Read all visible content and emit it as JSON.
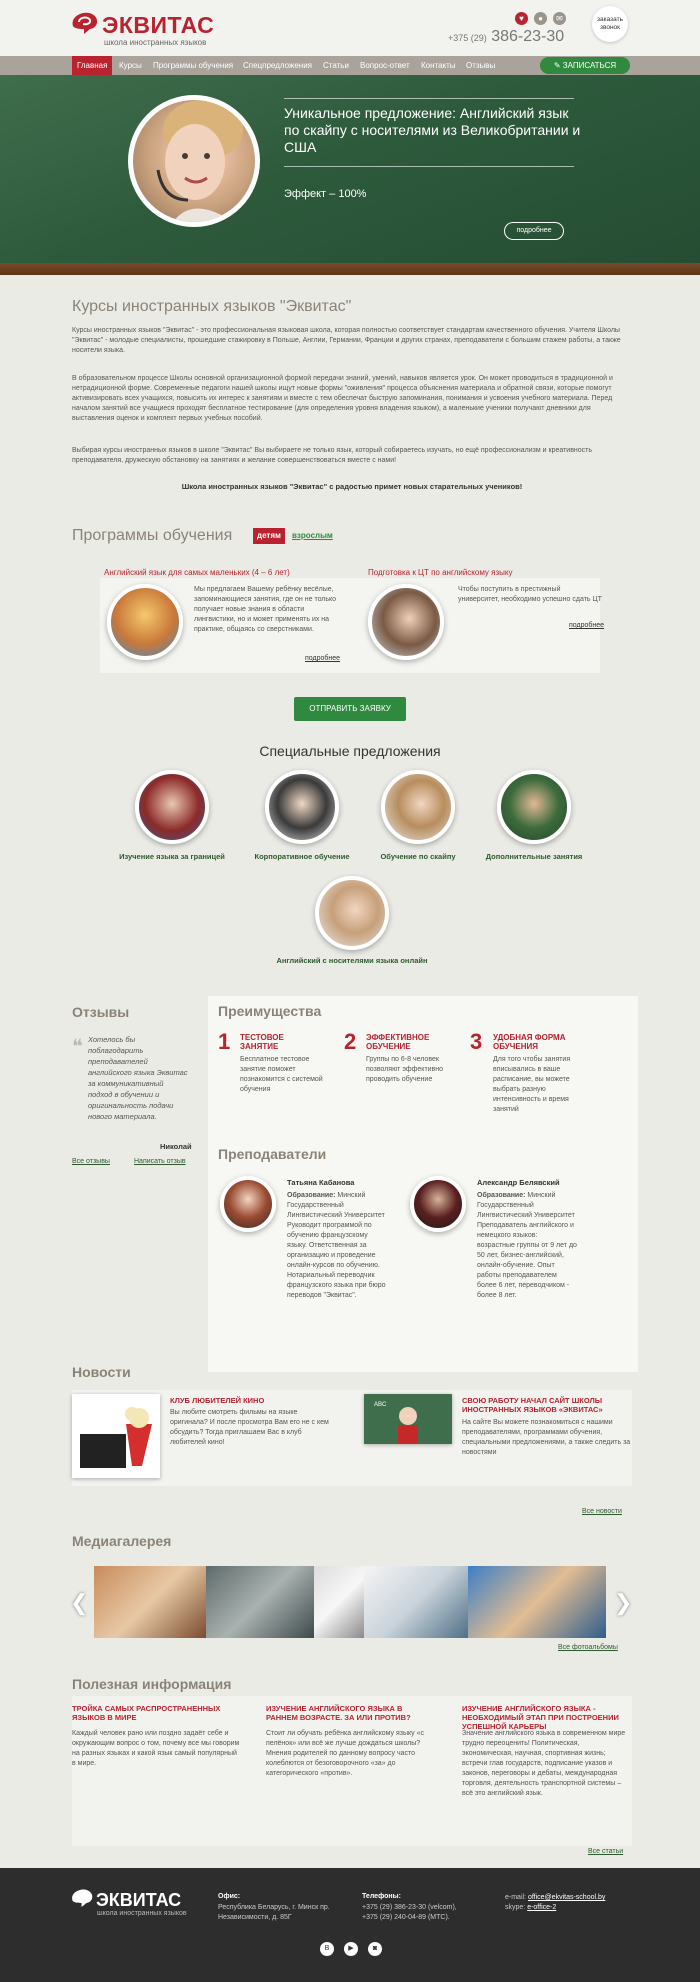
{
  "header": {
    "logo_text": "ЭКВИТАС",
    "logo_sub": "школа иностранных языков",
    "phone_code": "+375 (29)",
    "phone_number": "386-23-30",
    "callback": "заказать звонок",
    "icons": [
      "heart-icon",
      "person-icon",
      "mail-icon"
    ]
  },
  "nav": {
    "items": [
      "Главная",
      "Курсы",
      "Программы обучения",
      "Спецпредложения",
      "Статьи",
      "Вопрос-ответ",
      "Контакты",
      "Отзывы"
    ],
    "signup": "ЗАПИСАТЬСЯ"
  },
  "hero": {
    "title": "Уникальное предложение: Английский язык по скайпу с носителями из Великобритании и США",
    "effect": "Эффект – 100%",
    "more": "подробнее"
  },
  "about": {
    "title": "Курсы иностранных языков \"Эквитас\"",
    "p1": "Курсы иностранных языков \"Эквитас\" - это профессиональная языковая школа, которая полностью соответствует стандартам качественного обучения. Учителя Школы \"Эквитас\" - молодые специалисты, прошедшие стажировку в Польше, Англии, Германии, Франции и других странах, преподаватели с большим стажем работы, а также носители языка.",
    "p2": "В образовательном процессе Школы основной организационной формой передачи знаний, умений, навыков является урок. Он может проводиться в традиционной и нетрадиционной форме. Современные педагоги нашей школы ищут новые формы \"оживления\" процесса объяснения материала и обратной связи, которые помогут активизировать всех учащихся, повысить их интерес к занятиям и вместе с тем обеспечат быструю запоминания, понимания и усвоения учебного материала. Перед началом занятий все учащиеся проходят бесплатное тестирование (для определения уровня владения языком), а маленькие ученики получают дневники для выставления оценок и комплект первых учебных пособий.",
    "p3": "Выбирая курсы иностранных языков в школе \"Эквитас\" Вы выбираете не только язык, который собираетесь изучать, но ещё профессионализм и креативность преподавателя, дружескую обстановку на занятиях и желание совершенствоваться вместе с нами!",
    "tagline": "Школа иностранных языков \"Эквитас\" с радостью примет новых старательных учеников!"
  },
  "programs": {
    "title": "Программы обучения",
    "tab_kids": "детям",
    "tab_adults": "взрослым",
    "items": [
      {
        "title": "Английский язык для самых маленьких (4 – 6 лет)",
        "text": "Мы предлагаем Вашему ребёнку весёлые, запоминающиеся занятия, где он не только получает новые знания в области лингвистики, но и может применять их на практике, общаясь со сверстниками.",
        "more": "подробнее"
      },
      {
        "title": "Подготовка к ЦТ по английскому языку",
        "text": "Чтобы поступить в престижный университет, необходимо успешно сдать ЦТ",
        "more": "подробнее"
      }
    ],
    "send": "ОТПРАВИТЬ ЗАЯВКУ"
  },
  "offers": {
    "title": "Специальные предложения",
    "items": [
      "Изучение языка за границей",
      "Корпоративное обучение",
      "Обучение по скайпу",
      "Дополнительные занятия",
      "Английский с носителями языка онлайн"
    ]
  },
  "reviews": {
    "title": "Отзывы",
    "quote": "Хотелось бы поблагодарить преподавателей английского языка Эквитас за коммуникативный подход в обучении и оригинальность подачи нового материала.",
    "author": "Николай",
    "all": "Все отзывы",
    "write": "Написать отзыв"
  },
  "advantages": {
    "title": "Преимущества",
    "items": [
      {
        "num": "1",
        "title": "ТЕСТОВОЕ ЗАНЯТИЕ",
        "text": "Бесплатное тестовое занятие поможет познакомится с системой обучения"
      },
      {
        "num": "2",
        "title": "ЭФФЕКТИВНОЕ ОБУЧЕНИЕ",
        "text": "Группы по 6-8 человек позволяют эффективно проводить обучение"
      },
      {
        "num": "3",
        "title": "УДОБНАЯ ФОРМА ОБУЧЕНИЯ",
        "text": "Для того чтобы занятия вписывались в ваше расписание, вы можете выбрать разную интенсивность и время занятий"
      }
    ]
  },
  "teachers": {
    "title": "Преподаватели",
    "items": [
      {
        "name": "Татьяна Кабанова",
        "label": "Образование:",
        "text": "Минский Государственный Лингвистический Университет Руководит программой по обучению французскому языку. Ответственная за организацию и проведение онлайн-курсов по обучению. Нотариальный переводчик французского языка при бюро переводов \"Эквитас\"."
      },
      {
        "name": "Александр Белявский",
        "label": "Образование:",
        "text": "Минский Государственный Лингвистический Университет Преподаватель английского и немецкого языков: возрастные группы от 9 лет до 50 лет, бизнес-английский, онлайн-обучение. Опыт работы преподавателем более 6 лет, переводчиком - более 8 лет."
      }
    ]
  },
  "news": {
    "title": "Новости",
    "items": [
      {
        "title": "КЛУБ ЛЮБИТЕЛЕЙ КИНО",
        "text": "Вы любите смотреть фильмы на языке оригинала? И после просмотра Вам его не с кем обсудить? Тогда приглашаем Вас в клуб любителей кино!"
      },
      {
        "title": "СВОЮ РАБОТУ НАЧАЛ САЙТ ШКОЛЫ ИНОСТРАННЫХ ЯЗЫКОВ «ЭКВИТАС»",
        "text": "На сайте Вы можете познакомиться с нашими преподавателями, программами обучения, специальными предложениями, а также следить за новостями"
      }
    ],
    "all": "Все новости"
  },
  "gallery": {
    "title": "Медиагалерея",
    "all": "Все фотоальбомы"
  },
  "info": {
    "title": "Полезная информация",
    "items": [
      {
        "title": "ТРОЙКА САМЫХ РАСПРОСТРАНЕННЫХ ЯЗЫКОВ В МИРЕ",
        "text": "Каждый человек рано или поздно задаёт себе и окружающим вопрос о том, почему все мы говорим на разных языках и какой язык самый популярный в мире."
      },
      {
        "title": "ИЗУЧЕНИЕ АНГЛИЙСКОГО ЯЗЫКА В РАННЕМ ВОЗРАСТЕ. ЗА ИЛИ ПРОТИВ?",
        "text": "Стоит ли обучать ребёнка английскому языку «с пелёнок» или всё же лучше дождаться школы? Мнения родителей по данному вопросу часто колеблются от безоговорочного «за» до категорического «против»."
      },
      {
        "title": "ИЗУЧЕНИЕ АНГЛИЙСКОГО ЯЗЫКА - НЕОБХОДИМЫЙ ЭТАП ПРИ ПОСТРОЕНИИ УСПЕШНОЙ КАРЬЕРЫ",
        "text": "Значение английского языка в современном мире трудно переоценить! Политическая, экономическая, научная, спортивная жизнь; встречи глав государств, подписание указов и законов, переговоры и дебаты, международная торговля, деятельность транспортной системы – всё это английский язык."
      }
    ],
    "all": "Все статьи"
  },
  "footer": {
    "logo_text": "ЭКВИТАС",
    "logo_sub": "школа иностранных языков",
    "office_label": "Офис:",
    "office": "Республика Беларусь, г. Минск пр. Независимости, д. 85Г",
    "phones_label": "Телефоны:",
    "phone1": "+375 (29) 386-23-30 (velcom),",
    "phone2": "+375 (29) 240-04-89 (МТС).",
    "email_label": "e-mail:",
    "email": "office@ekvitas-school.by",
    "skype_label": "skype:",
    "skype": "e-office-2",
    "socials": [
      "В",
      "▶",
      "◙"
    ]
  },
  "colors": {
    "accent": "#b8232f",
    "green": "#2f8a3f",
    "nav": "#a9a39b",
    "footer": "#2d2d2d"
  }
}
